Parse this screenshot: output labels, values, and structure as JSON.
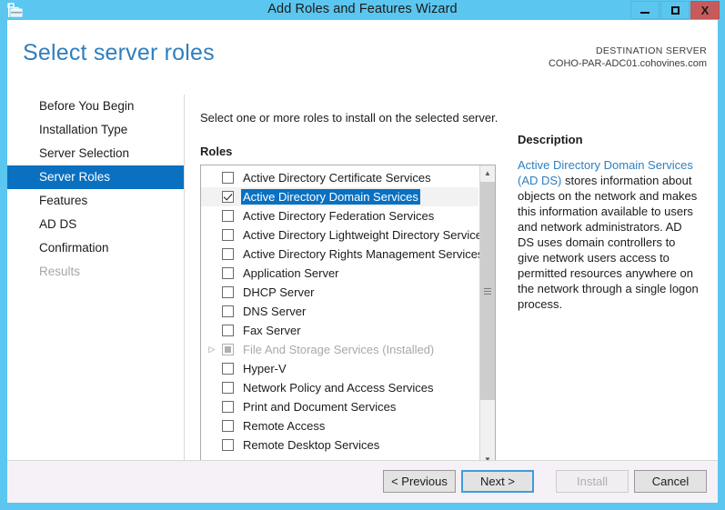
{
  "window": {
    "title": "Add Roles and Features Wizard",
    "icon": "server-manager-icon",
    "minimize_label": "Minimize",
    "maximize_label": "Maximize",
    "close_label": "X"
  },
  "header": {
    "page_title": "Select server roles",
    "destination_label": "DESTINATION SERVER",
    "destination_server": "COHO-PAR-ADC01.cohovines.com"
  },
  "sidebar": {
    "items": [
      {
        "label": "Before You Begin",
        "state": "normal"
      },
      {
        "label": "Installation Type",
        "state": "normal"
      },
      {
        "label": "Server Selection",
        "state": "normal"
      },
      {
        "label": "Server Roles",
        "state": "active"
      },
      {
        "label": "Features",
        "state": "normal"
      },
      {
        "label": "AD DS",
        "state": "normal"
      },
      {
        "label": "Confirmation",
        "state": "normal"
      },
      {
        "label": "Results",
        "state": "disabled"
      }
    ]
  },
  "main": {
    "instruction": "Select one or more roles to install on the selected server.",
    "roles_label": "Roles",
    "roles": [
      {
        "label": "Active Directory Certificate Services",
        "checked": false,
        "selected": false,
        "dimmed": false,
        "expandable": false
      },
      {
        "label": "Active Directory Domain Services",
        "checked": true,
        "selected": true,
        "dimmed": false,
        "expandable": false
      },
      {
        "label": "Active Directory Federation Services",
        "checked": false,
        "selected": false,
        "dimmed": false,
        "expandable": false
      },
      {
        "label": "Active Directory Lightweight Directory Services",
        "checked": false,
        "selected": false,
        "dimmed": false,
        "expandable": false
      },
      {
        "label": "Active Directory Rights Management Services",
        "checked": false,
        "selected": false,
        "dimmed": false,
        "expandable": false
      },
      {
        "label": "Application Server",
        "checked": false,
        "selected": false,
        "dimmed": false,
        "expandable": false
      },
      {
        "label": "DHCP Server",
        "checked": false,
        "selected": false,
        "dimmed": false,
        "expandable": false
      },
      {
        "label": "DNS Server",
        "checked": false,
        "selected": false,
        "dimmed": false,
        "expandable": false
      },
      {
        "label": "Fax Server",
        "checked": false,
        "selected": false,
        "dimmed": false,
        "expandable": false
      },
      {
        "label": "File And Storage Services (Installed)",
        "checked": "indeterminate",
        "selected": false,
        "dimmed": true,
        "expandable": true
      },
      {
        "label": "Hyper-V",
        "checked": false,
        "selected": false,
        "dimmed": false,
        "expandable": false
      },
      {
        "label": "Network Policy and Access Services",
        "checked": false,
        "selected": false,
        "dimmed": false,
        "expandable": false
      },
      {
        "label": "Print and Document Services",
        "checked": false,
        "selected": false,
        "dimmed": false,
        "expandable": false
      },
      {
        "label": "Remote Access",
        "checked": false,
        "selected": false,
        "dimmed": false,
        "expandable": false
      },
      {
        "label": "Remote Desktop Services",
        "checked": false,
        "selected": false,
        "dimmed": false,
        "expandable": false
      }
    ]
  },
  "description": {
    "title": "Description",
    "link_text": "Active Directory Domain Services (AD DS)",
    "body_text": " stores information about objects on the network and makes this information available to users and network administrators. AD DS uses domain controllers to give network users access to permitted resources anywhere on the network through a single logon process."
  },
  "footer": {
    "previous": "< Previous",
    "next": "Next >",
    "install": "Install",
    "cancel": "Cancel"
  },
  "colors": {
    "accent_cyan": "#5bc6ef",
    "selection_blue": "#0a70c0",
    "link_blue": "#2f7fbf",
    "close_red": "#c75b5b"
  }
}
